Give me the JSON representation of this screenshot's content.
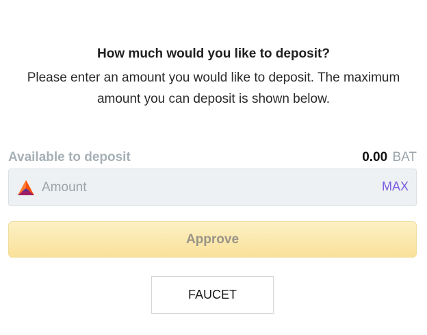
{
  "deposit": {
    "heading": "How much would you like to deposit?",
    "description": "Please enter an amount you would like to deposit. The maximum amount you can deposit is shown below."
  },
  "available": {
    "label": "Available to deposit",
    "amount": "0.00",
    "unit": "BAT"
  },
  "amount_input": {
    "placeholder": "Amount",
    "value": "",
    "icon": "bat-token-icon",
    "max_label": "MAX"
  },
  "approve_button": {
    "label": "Approve"
  },
  "faucet_button": {
    "label": "FAUCET"
  },
  "colors": {
    "max_accent": "#7b5ce0",
    "approve_bg": "#f9e199",
    "bat_orange": "#ff5000",
    "bat_purple": "#662d91"
  }
}
